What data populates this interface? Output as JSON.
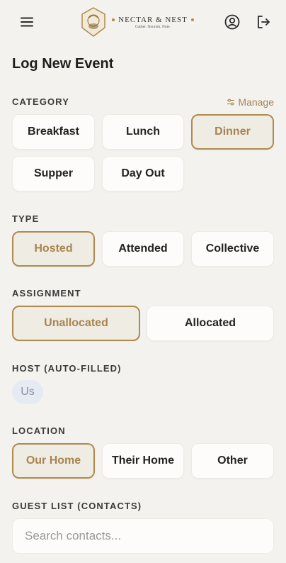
{
  "header": {
    "brand_name": "NECTAR & NEST",
    "brand_tagline": "Gather. Nourish. Note.",
    "menu_icon": "hamburger-icon",
    "profile_icon": "user-circle-icon",
    "logout_icon": "logout-icon",
    "accent": "#b08a4e"
  },
  "page": {
    "title": "Log New Event"
  },
  "category": {
    "label": "CATEGORY",
    "manage_label": "Manage",
    "options": [
      "Breakfast",
      "Lunch",
      "Dinner",
      "Supper",
      "Day Out"
    ],
    "selected": "Dinner"
  },
  "type": {
    "label": "TYPE",
    "options": [
      "Hosted",
      "Attended",
      "Collective"
    ],
    "selected": "Hosted"
  },
  "assignment": {
    "label": "ASSIGNMENT",
    "options": [
      "Unallocated",
      "Allocated"
    ],
    "selected": "Unallocated"
  },
  "host": {
    "label": "HOST (AUTO-FILLED)",
    "value": "Us"
  },
  "location": {
    "label": "LOCATION",
    "options": [
      "Our Home",
      "Their Home",
      "Other"
    ],
    "selected": "Our Home"
  },
  "guests": {
    "label": "GUEST LIST (CONTACTS)",
    "placeholder": "Search contacts..."
  }
}
